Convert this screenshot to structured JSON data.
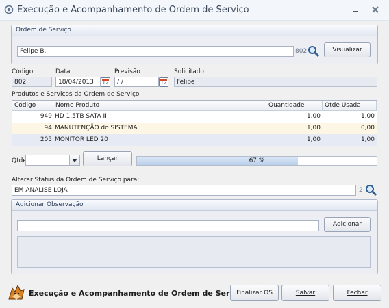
{
  "window": {
    "title": "Execução e Acompanhamento de Ordem de Serviço"
  },
  "order_group": {
    "title": "Ordem de Serviço",
    "client_value": "Felipe B.",
    "client_code": "802",
    "view_button": "Visualizar"
  },
  "fields": {
    "codigo_label": "Código",
    "codigo_value": "802",
    "data_label": "Data",
    "data_value": "18/04/2013",
    "previsao_label": "Previsão",
    "previsao_value": " /  /",
    "calendar_icon_text": "12",
    "solicitado_label": "Solicitado",
    "solicitado_value": "Felipe"
  },
  "products": {
    "title": "Produtos e Serviços da Ordem de Serviço",
    "columns": [
      "Código",
      "Nome Produto",
      "Quantidade",
      "Qtde Usada"
    ],
    "rows": [
      {
        "codigo": "949",
        "nome": "HD 1.5TB SATA II",
        "quantidade": "1,00",
        "usada": "1,00"
      },
      {
        "codigo": "94",
        "nome": "MANUTENÇÃO do SISTEMA",
        "quantidade": "1,00",
        "usada": "0,00"
      },
      {
        "codigo": "205",
        "nome": "MONITOR LED 20",
        "quantidade": "1,00",
        "usada": "1,00"
      }
    ]
  },
  "entry": {
    "qtde_label": "Qtde",
    "qtde_value": "",
    "launch_button": "Lançar"
  },
  "progress": {
    "percent": 67,
    "text": "67 %"
  },
  "status": {
    "label": "Alterar Status da Ordem de Serviço para:",
    "value": "EM ANALISE LOJA",
    "code": "2"
  },
  "observation": {
    "title": "Adicionar Observação",
    "input_value": "",
    "add_button": "Adicionar",
    "list_value": ""
  },
  "footer": {
    "title": "Execução e Acompanhamento de Ordem de Serviço",
    "finalize_button": "Finalizar OS",
    "save_button": "Salvar",
    "close_button": "Fechar"
  },
  "icons": {
    "app": "app-icon",
    "search": "magnifier-icon",
    "calendar": "calendar-icon",
    "dropdown": "chevron-down-icon",
    "logo": "fox-logo"
  },
  "colors": {
    "row_highlight": "#fdf6e4",
    "row_selected": "#e5eaf5",
    "progress_fill": "#b9cfeb"
  }
}
